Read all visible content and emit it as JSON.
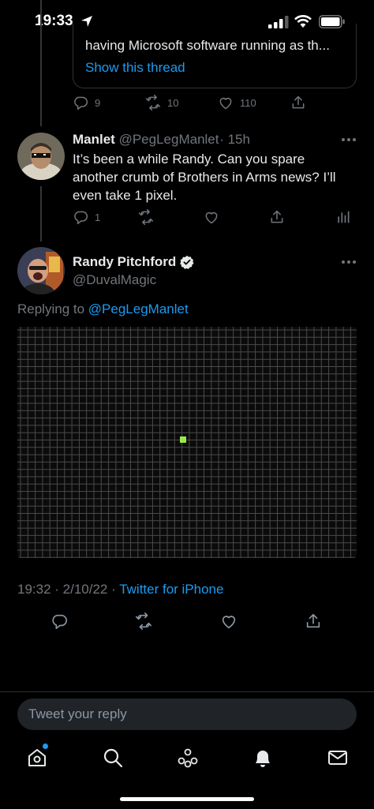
{
  "status_bar": {
    "time": "19:33"
  },
  "quoted": {
    "text": "having Microsoft software running as th...",
    "link": "Show this thread",
    "replies": "9",
    "retweets": "10",
    "likes": "110"
  },
  "tweet1": {
    "name": "Manlet",
    "handle": "@PegLegManlet",
    "age": "· 15h",
    "body": "It’s been a while Randy. Can you spare another crumb of Brothers in Arms news? I’ll even take 1 pixel.",
    "replies": "1"
  },
  "tweet2": {
    "name": "Randy Pitchford",
    "handle": "@DuvalMagic",
    "replying_prefix": "Replying to",
    "replying_to": "@PegLegManlet",
    "timestamp": "19:32 · 2/10/22 ·",
    "source": "Twitter for iPhone",
    "pixel_color": "#9be84a"
  },
  "reply_input": {
    "placeholder": "Tweet your reply"
  },
  "colors": {
    "accent": "#1d9bf0",
    "background": "#000000",
    "muted": "#71767b"
  },
  "icons": [
    "location-arrow-icon",
    "signal-icon",
    "wifi-icon",
    "battery-icon",
    "reply-icon",
    "retweet-icon",
    "like-icon",
    "share-icon",
    "analytics-icon",
    "verified-icon",
    "more-icon",
    "home-icon",
    "search-icon",
    "spaces-icon",
    "notifications-icon",
    "messages-icon"
  ]
}
